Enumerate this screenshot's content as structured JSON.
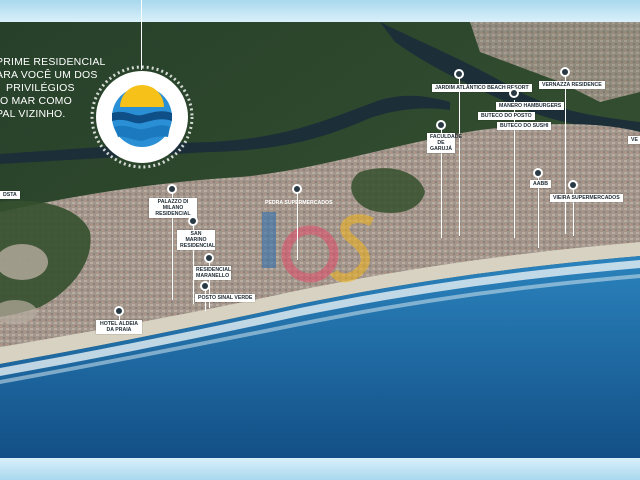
{
  "tagline": {
    "line1": "PRIME RESIDENCIAL",
    "line2": "ARA VOCÊ UM DOS",
    "line3": "PRIVILÉGIOS",
    "line4": "O MAR COMO",
    "line5": "PAL VIZINHO."
  },
  "colors": {
    "sea": "#1f72ad",
    "sea_deep": "#134f86",
    "forest": "#2f4a2c",
    "urban": "#9b8f86",
    "foam": "#e9f1f4",
    "frame": "#cfe9f5",
    "pin": "#ffffff"
  },
  "places": {
    "jardim_atlantico": "JARDIM ATLÂNTICO BEACH RESORT",
    "vernazza": "VERNAZZA RESIDENCE",
    "manero": "MANERO HAMBURGERS",
    "buteco_posto": "BUTECO DO POSTO",
    "buteco_sushi": "BUTECO DO SUSHI",
    "faculdade": "FACULDADE DE GARUJÁ",
    "aabb": "AABB",
    "vieira": "VIEIRA SUPERMERCADOS",
    "pedra": "PEDRA SUPERMERCADOS",
    "palazzo": "PALAZZO DI MILANO RESIDENCIAL",
    "san_marino": "SAN MARINO RESIDENCIAL",
    "maranello": "RESIDENCIAL MARANELLO",
    "sinal_verde": "POSTO SINAL VERDE",
    "hotel": "HOTEL ALDEIA DA PRAIA",
    "edge_left": "DSTA",
    "edge_right": "VE"
  },
  "icons": {
    "logo": "sunset-over-sea-logo",
    "pin": "map-pin-icon"
  }
}
